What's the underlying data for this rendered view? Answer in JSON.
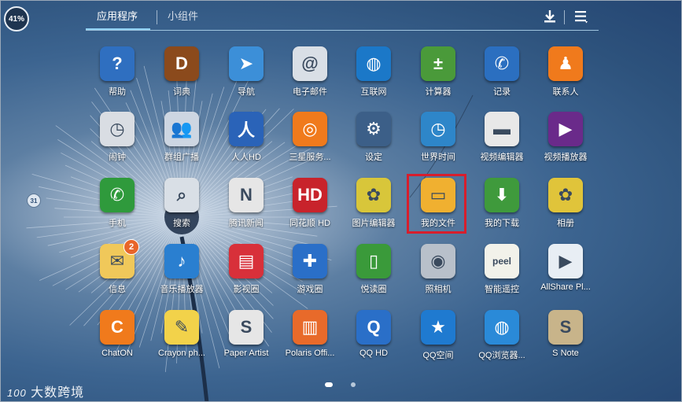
{
  "status": {
    "battery": "41%"
  },
  "tabs": {
    "apps": "应用程序",
    "widgets": "小组件"
  },
  "watermark": {
    "num": "100",
    "text": "大数跨境"
  },
  "side_handle": "31",
  "apps": [
    {
      "label": "帮助",
      "icon": "help-icon",
      "color": "#2f6fc0",
      "glyph": "?"
    },
    {
      "label": "词典",
      "icon": "dictionary-icon",
      "color": "#8b4a1c",
      "glyph": "D"
    },
    {
      "label": "导航",
      "icon": "compass-icon",
      "color": "#3c8fd8",
      "glyph": "➤"
    },
    {
      "label": "电子邮件",
      "icon": "email-icon",
      "color": "#d9dfe6",
      "glyph": "@"
    },
    {
      "label": "互联网",
      "icon": "globe-icon",
      "color": "#1b78c8",
      "glyph": "◍"
    },
    {
      "label": "计算器",
      "icon": "calculator-icon",
      "color": "#4a9a3a",
      "glyph": "±"
    },
    {
      "label": "记录",
      "icon": "call-log-icon",
      "color": "#2b6fc0",
      "glyph": "✆"
    },
    {
      "label": "联系人",
      "icon": "contacts-icon",
      "color": "#f07a1c",
      "glyph": "♟"
    },
    {
      "label": "闹钟",
      "icon": "alarm-clock-icon",
      "color": "#d9dde3",
      "glyph": "◷"
    },
    {
      "label": "群组广播",
      "icon": "group-cast-icon",
      "color": "#cdd6e2",
      "glyph": "👥"
    },
    {
      "label": "人人HD",
      "icon": "renren-icon",
      "color": "#2a63b8",
      "glyph": "人"
    },
    {
      "label": "三星服务...",
      "icon": "samsung-service-icon",
      "color": "#f07a1c",
      "glyph": "◎"
    },
    {
      "label": "设定",
      "icon": "settings-gear-icon",
      "color": "#3c5f88",
      "glyph": "⚙"
    },
    {
      "label": "世界时间",
      "icon": "world-clock-icon",
      "color": "#2e86c9",
      "glyph": "◷"
    },
    {
      "label": "视频编辑器",
      "icon": "clapper-icon",
      "color": "#e8e8e8",
      "glyph": "▬"
    },
    {
      "label": "视频播放器",
      "icon": "video-player-icon",
      "color": "#6a2a8a",
      "glyph": "▶"
    },
    {
      "label": "手机",
      "icon": "phone-icon",
      "color": "#2f9a3c",
      "glyph": "✆"
    },
    {
      "label": "搜索",
      "icon": "search-icon",
      "color": "#d9dfe6",
      "glyph": "⌕"
    },
    {
      "label": "腾讯新闻",
      "icon": "tencent-news-icon",
      "color": "#e6e6e6",
      "glyph": "N"
    },
    {
      "label": "同花顺 HD",
      "icon": "stock-chart-icon",
      "color": "#c8232b",
      "glyph": "HD"
    },
    {
      "label": "图片编辑器",
      "icon": "photo-editor-icon",
      "color": "#d8c63a",
      "glyph": "✿"
    },
    {
      "label": "我的文件",
      "icon": "folder-icon",
      "color": "#f0b030",
      "glyph": "▭"
    },
    {
      "label": "我的下载",
      "icon": "download-icon",
      "color": "#3f9a3c",
      "glyph": "⬇"
    },
    {
      "label": "相册",
      "icon": "gallery-icon",
      "color": "#e0c43a",
      "glyph": "✿"
    },
    {
      "label": "信息",
      "icon": "messages-icon",
      "color": "#f0c85a",
      "glyph": "✉",
      "badge": "2"
    },
    {
      "label": "音乐播放器",
      "icon": "music-player-icon",
      "color": "#2a7fd0",
      "glyph": "♪"
    },
    {
      "label": "影视圈",
      "icon": "film-icon",
      "color": "#d8303a",
      "glyph": "▤"
    },
    {
      "label": "游戏圈",
      "icon": "gamepad-icon",
      "color": "#2a6fc8",
      "glyph": "✚"
    },
    {
      "label": "悦读圈",
      "icon": "reading-icon",
      "color": "#3a9a3a",
      "glyph": "▯"
    },
    {
      "label": "照相机",
      "icon": "camera-icon",
      "color": "#b8c0ca",
      "glyph": "◉"
    },
    {
      "label": "智能遥控",
      "icon": "peel-remote-icon",
      "color": "#f2f2ea",
      "glyph": "peel"
    },
    {
      "label": "AllShare Pl...",
      "icon": "allshare-icon",
      "color": "#e8eef4",
      "glyph": "▶"
    },
    {
      "label": "ChatON",
      "icon": "chaton-icon",
      "color": "#f07a1c",
      "glyph": "C"
    },
    {
      "label": "Crayon ph...",
      "icon": "crayon-physics-icon",
      "color": "#f2d24a",
      "glyph": "✎"
    },
    {
      "label": "Paper Artist",
      "icon": "paper-artist-icon",
      "color": "#e6e6e6",
      "glyph": "S"
    },
    {
      "label": "Polaris Offi...",
      "icon": "polaris-office-icon",
      "color": "#e86a2a",
      "glyph": "▥"
    },
    {
      "label": "QQ HD",
      "icon": "qq-penguin-icon",
      "color": "#2a6fc8",
      "glyph": "Q"
    },
    {
      "label": "QQ空间",
      "icon": "qzone-star-icon",
      "color": "#1f7ad0",
      "glyph": "★"
    },
    {
      "label": "QQ浏览器...",
      "icon": "qq-browser-icon",
      "color": "#2a8ad8",
      "glyph": "◍"
    },
    {
      "label": "S Note",
      "icon": "s-note-icon",
      "color": "#c8b48a",
      "glyph": "S"
    }
  ]
}
